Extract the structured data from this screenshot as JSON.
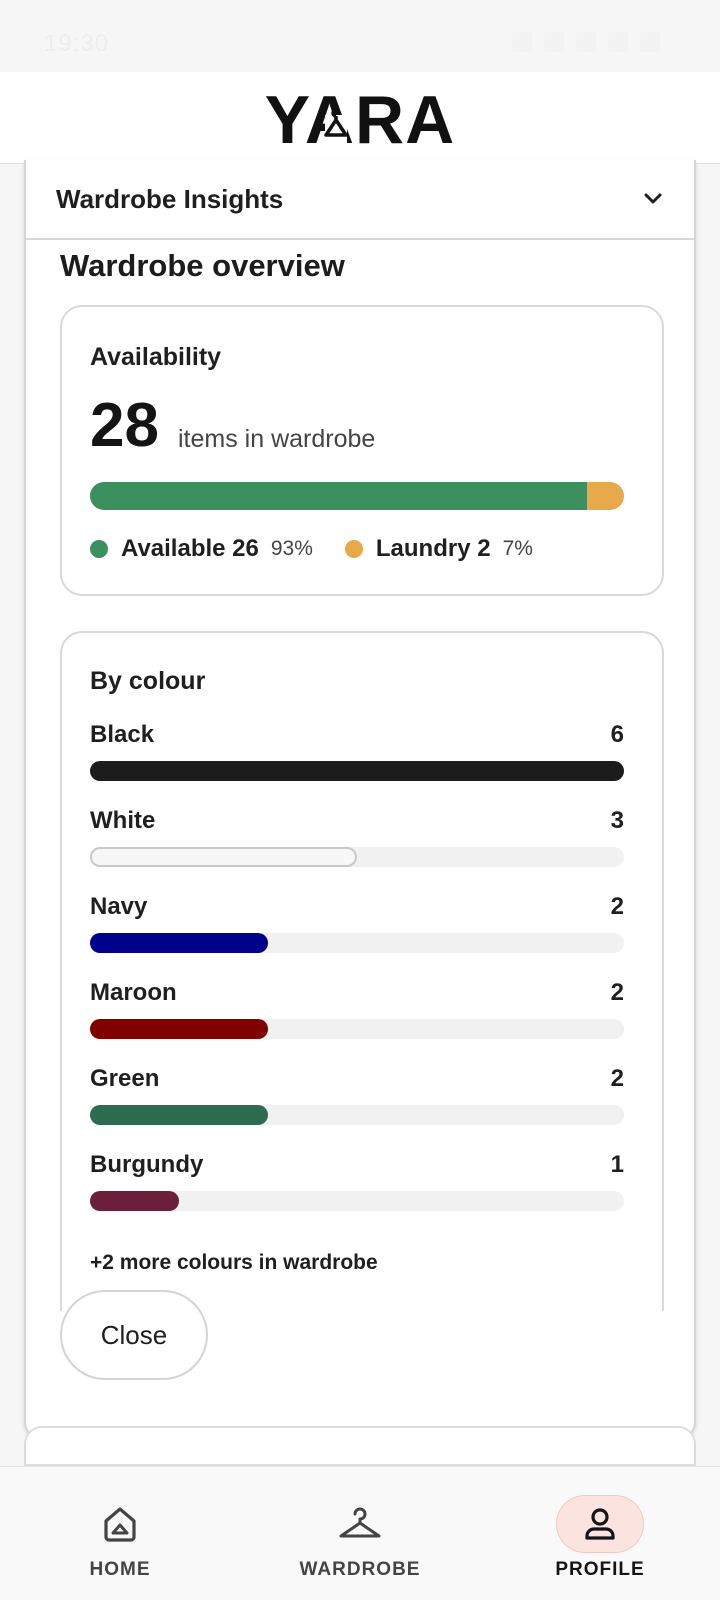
{
  "status_bar": {
    "time": "19:30"
  },
  "header": {
    "brand": "YARA"
  },
  "sheet": {
    "title": "Wardrobe Insights",
    "section_title": "Wardrobe overview"
  },
  "availability": {
    "label": "Availability",
    "total": "28",
    "total_suffix": "items in wardrobe",
    "available": {
      "label": "Available 26",
      "pct": "93%",
      "fraction": 0.93,
      "color": "#3c8f5f"
    },
    "laundry": {
      "label": "Laundry 2",
      "pct": "7%",
      "fraction": 0.07,
      "color": "#e8a94a"
    }
  },
  "by_colour": {
    "label": "By colour",
    "max": 6,
    "rows": [
      {
        "name": "Black",
        "count": "6",
        "value": 6,
        "color": "#1c1c1c"
      },
      {
        "name": "White",
        "count": "3",
        "value": 3,
        "color": "#f2f2f2"
      },
      {
        "name": "Navy",
        "count": "2",
        "value": 2,
        "color": "#00008b"
      },
      {
        "name": "Maroon",
        "count": "2",
        "value": 2,
        "color": "#800000"
      },
      {
        "name": "Green",
        "count": "2",
        "value": 2,
        "color": "#2e6b50"
      },
      {
        "name": "Burgundy",
        "count": "1",
        "value": 1,
        "color": "#6b1f3a"
      }
    ],
    "more_text": "+2 more colours in wardrobe"
  },
  "actions": {
    "close_label": "Close"
  },
  "nav": {
    "items": [
      {
        "label": "HOME",
        "icon": "home-icon",
        "active": false
      },
      {
        "label": "WARDROBE",
        "icon": "hanger-icon",
        "active": false
      },
      {
        "label": "PROFILE",
        "icon": "person-icon",
        "active": true
      }
    ]
  }
}
